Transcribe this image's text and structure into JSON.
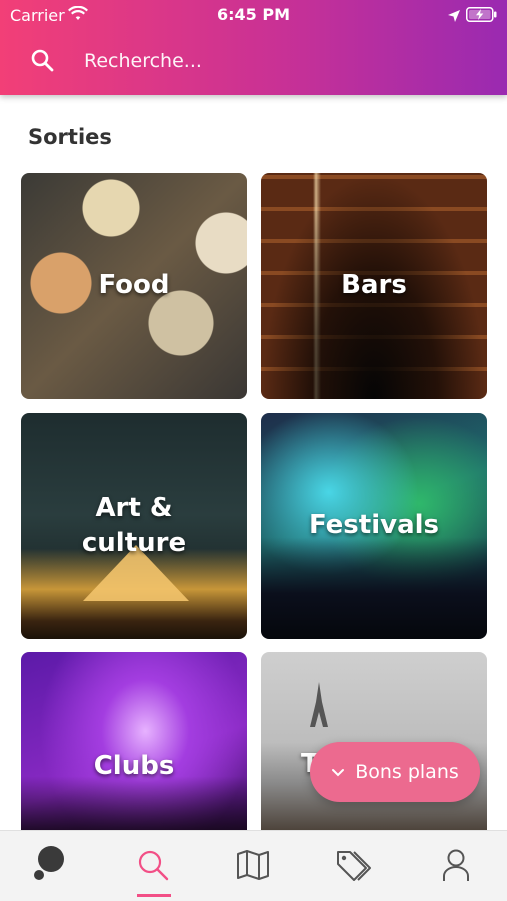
{
  "status_bar": {
    "carrier": "Carrier",
    "time": "6:45 PM",
    "wifi_icon": "wifi-icon",
    "location_icon": "location-arrow-icon",
    "battery_icon": "battery-charging-icon"
  },
  "search": {
    "placeholder": "Recherche...",
    "icon": "search-icon"
  },
  "section": {
    "title": "Sorties"
  },
  "categories": [
    {
      "label": "Food"
    },
    {
      "label": "Bars"
    },
    {
      "label": "Art &\nculture"
    },
    {
      "label": "Festivals"
    },
    {
      "label": "Clubs"
    },
    {
      "label": "T"
    }
  ],
  "bons_plans": {
    "label": "Bons plans",
    "icon": "chevron-down-icon"
  },
  "tab_bar": {
    "items": [
      {
        "icon": "profile-blob-icon"
      },
      {
        "icon": "search-icon",
        "active": true
      },
      {
        "icon": "map-icon"
      },
      {
        "icon": "tags-icon"
      },
      {
        "icon": "user-icon"
      }
    ]
  },
  "colors": {
    "header_gradient_start": "#f23f77",
    "header_gradient_end": "#9a2ab1",
    "accent_pink": "#f24f86",
    "button_pink": "#ec6a8f"
  }
}
